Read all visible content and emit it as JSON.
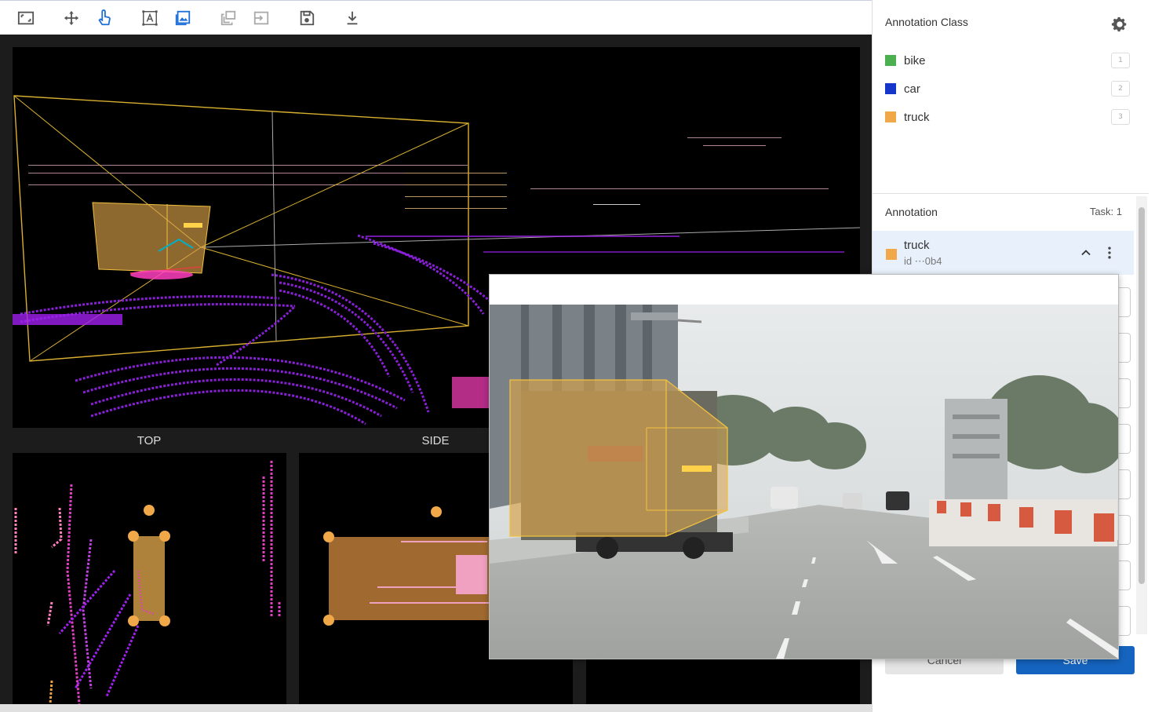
{
  "toolbar": {
    "tools": [
      {
        "icon": "fit-view-icon"
      },
      {
        "icon": "move-icon"
      },
      {
        "icon": "pointer-hand-icon"
      },
      {
        "icon": "text-box-icon"
      },
      {
        "icon": "image-view-icon"
      },
      {
        "icon": "copy-layers-icon"
      },
      {
        "icon": "import-icon"
      },
      {
        "icon": "save-disk-icon"
      },
      {
        "icon": "download-icon"
      }
    ]
  },
  "views": {
    "top_label": "TOP",
    "side_label": "SIDE"
  },
  "sidebar": {
    "class_header": "Annotation Class",
    "classes": [
      {
        "label": "bike",
        "color": "#4caf50",
        "hotkey": "1"
      },
      {
        "label": "car",
        "color": "#1536c8",
        "hotkey": "2"
      },
      {
        "label": "truck",
        "color": "#f0a848",
        "hotkey": "3"
      }
    ],
    "annotation_header": "Annotation",
    "task_label": "Task: 1",
    "annotation": {
      "name": "truck",
      "id": "id ⋯0b4",
      "color": "#f0a848"
    },
    "cancel_label": "Cancel",
    "save_label": "Save"
  },
  "colors": {
    "accent": "#1565c0",
    "box_fill": "#d9a24a",
    "box_edge": "#f0c040",
    "lidar_purple": "#8a1fd8",
    "lidar_pink": "#e040c0"
  }
}
